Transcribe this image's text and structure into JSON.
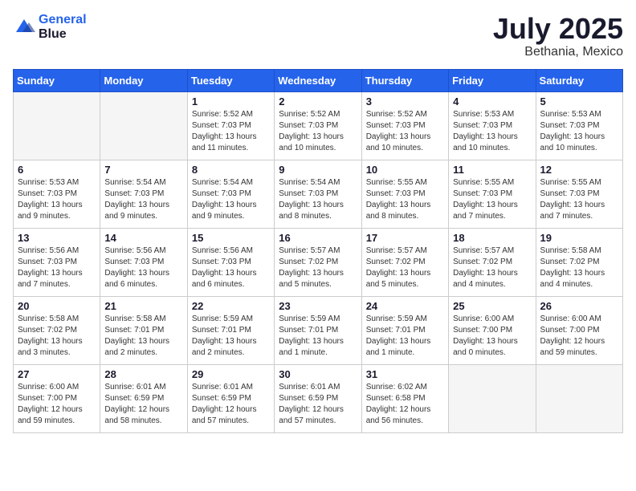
{
  "header": {
    "logo_line1": "General",
    "logo_line2": "Blue",
    "month_title": "July 2025",
    "location": "Bethania, Mexico"
  },
  "weekdays": [
    "Sunday",
    "Monday",
    "Tuesday",
    "Wednesday",
    "Thursday",
    "Friday",
    "Saturday"
  ],
  "weeks": [
    [
      {
        "day": "",
        "info": ""
      },
      {
        "day": "",
        "info": ""
      },
      {
        "day": "1",
        "info": "Sunrise: 5:52 AM\nSunset: 7:03 PM\nDaylight: 13 hours\nand 11 minutes."
      },
      {
        "day": "2",
        "info": "Sunrise: 5:52 AM\nSunset: 7:03 PM\nDaylight: 13 hours\nand 10 minutes."
      },
      {
        "day": "3",
        "info": "Sunrise: 5:52 AM\nSunset: 7:03 PM\nDaylight: 13 hours\nand 10 minutes."
      },
      {
        "day": "4",
        "info": "Sunrise: 5:53 AM\nSunset: 7:03 PM\nDaylight: 13 hours\nand 10 minutes."
      },
      {
        "day": "5",
        "info": "Sunrise: 5:53 AM\nSunset: 7:03 PM\nDaylight: 13 hours\nand 10 minutes."
      }
    ],
    [
      {
        "day": "6",
        "info": "Sunrise: 5:53 AM\nSunset: 7:03 PM\nDaylight: 13 hours\nand 9 minutes."
      },
      {
        "day": "7",
        "info": "Sunrise: 5:54 AM\nSunset: 7:03 PM\nDaylight: 13 hours\nand 9 minutes."
      },
      {
        "day": "8",
        "info": "Sunrise: 5:54 AM\nSunset: 7:03 PM\nDaylight: 13 hours\nand 9 minutes."
      },
      {
        "day": "9",
        "info": "Sunrise: 5:54 AM\nSunset: 7:03 PM\nDaylight: 13 hours\nand 8 minutes."
      },
      {
        "day": "10",
        "info": "Sunrise: 5:55 AM\nSunset: 7:03 PM\nDaylight: 13 hours\nand 8 minutes."
      },
      {
        "day": "11",
        "info": "Sunrise: 5:55 AM\nSunset: 7:03 PM\nDaylight: 13 hours\nand 7 minutes."
      },
      {
        "day": "12",
        "info": "Sunrise: 5:55 AM\nSunset: 7:03 PM\nDaylight: 13 hours\nand 7 minutes."
      }
    ],
    [
      {
        "day": "13",
        "info": "Sunrise: 5:56 AM\nSunset: 7:03 PM\nDaylight: 13 hours\nand 7 minutes."
      },
      {
        "day": "14",
        "info": "Sunrise: 5:56 AM\nSunset: 7:03 PM\nDaylight: 13 hours\nand 6 minutes."
      },
      {
        "day": "15",
        "info": "Sunrise: 5:56 AM\nSunset: 7:03 PM\nDaylight: 13 hours\nand 6 minutes."
      },
      {
        "day": "16",
        "info": "Sunrise: 5:57 AM\nSunset: 7:02 PM\nDaylight: 13 hours\nand 5 minutes."
      },
      {
        "day": "17",
        "info": "Sunrise: 5:57 AM\nSunset: 7:02 PM\nDaylight: 13 hours\nand 5 minutes."
      },
      {
        "day": "18",
        "info": "Sunrise: 5:57 AM\nSunset: 7:02 PM\nDaylight: 13 hours\nand 4 minutes."
      },
      {
        "day": "19",
        "info": "Sunrise: 5:58 AM\nSunset: 7:02 PM\nDaylight: 13 hours\nand 4 minutes."
      }
    ],
    [
      {
        "day": "20",
        "info": "Sunrise: 5:58 AM\nSunset: 7:02 PM\nDaylight: 13 hours\nand 3 minutes."
      },
      {
        "day": "21",
        "info": "Sunrise: 5:58 AM\nSunset: 7:01 PM\nDaylight: 13 hours\nand 2 minutes."
      },
      {
        "day": "22",
        "info": "Sunrise: 5:59 AM\nSunset: 7:01 PM\nDaylight: 13 hours\nand 2 minutes."
      },
      {
        "day": "23",
        "info": "Sunrise: 5:59 AM\nSunset: 7:01 PM\nDaylight: 13 hours\nand 1 minute."
      },
      {
        "day": "24",
        "info": "Sunrise: 5:59 AM\nSunset: 7:01 PM\nDaylight: 13 hours\nand 1 minute."
      },
      {
        "day": "25",
        "info": "Sunrise: 6:00 AM\nSunset: 7:00 PM\nDaylight: 13 hours\nand 0 minutes."
      },
      {
        "day": "26",
        "info": "Sunrise: 6:00 AM\nSunset: 7:00 PM\nDaylight: 12 hours\nand 59 minutes."
      }
    ],
    [
      {
        "day": "27",
        "info": "Sunrise: 6:00 AM\nSunset: 7:00 PM\nDaylight: 12 hours\nand 59 minutes."
      },
      {
        "day": "28",
        "info": "Sunrise: 6:01 AM\nSunset: 6:59 PM\nDaylight: 12 hours\nand 58 minutes."
      },
      {
        "day": "29",
        "info": "Sunrise: 6:01 AM\nSunset: 6:59 PM\nDaylight: 12 hours\nand 57 minutes."
      },
      {
        "day": "30",
        "info": "Sunrise: 6:01 AM\nSunset: 6:59 PM\nDaylight: 12 hours\nand 57 minutes."
      },
      {
        "day": "31",
        "info": "Sunrise: 6:02 AM\nSunset: 6:58 PM\nDaylight: 12 hours\nand 56 minutes."
      },
      {
        "day": "",
        "info": ""
      },
      {
        "day": "",
        "info": ""
      }
    ]
  ]
}
